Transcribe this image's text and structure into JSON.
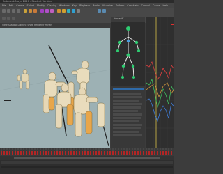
{
  "window": {
    "title": "Autodesk Maya 2020 - Student Version"
  },
  "menubar": {
    "items": [
      "File",
      "Edit",
      "Create",
      "Select",
      "Modify",
      "Display",
      "Windows",
      "Key",
      "Playback",
      "Audio",
      "Visualize",
      "Deform",
      "Constrain",
      "Control",
      "Cache",
      "Help"
    ]
  },
  "shelf": {
    "tool_icons": [
      "select-tool-icon",
      "move-tool-icon",
      "rotate-tool-icon",
      "scale-tool-icon",
      "key-icon"
    ]
  },
  "colors": {
    "viewport_bg": "#9db1b4",
    "timeline_key": "#d32020",
    "character": "#e8d29a",
    "skeleton_joint": "#2ecc71"
  },
  "panels": {
    "skeleton_picker": "HumanIK",
    "viewport_menu": "View  Shading  Lighting  Show  Renderer  Panels"
  }
}
